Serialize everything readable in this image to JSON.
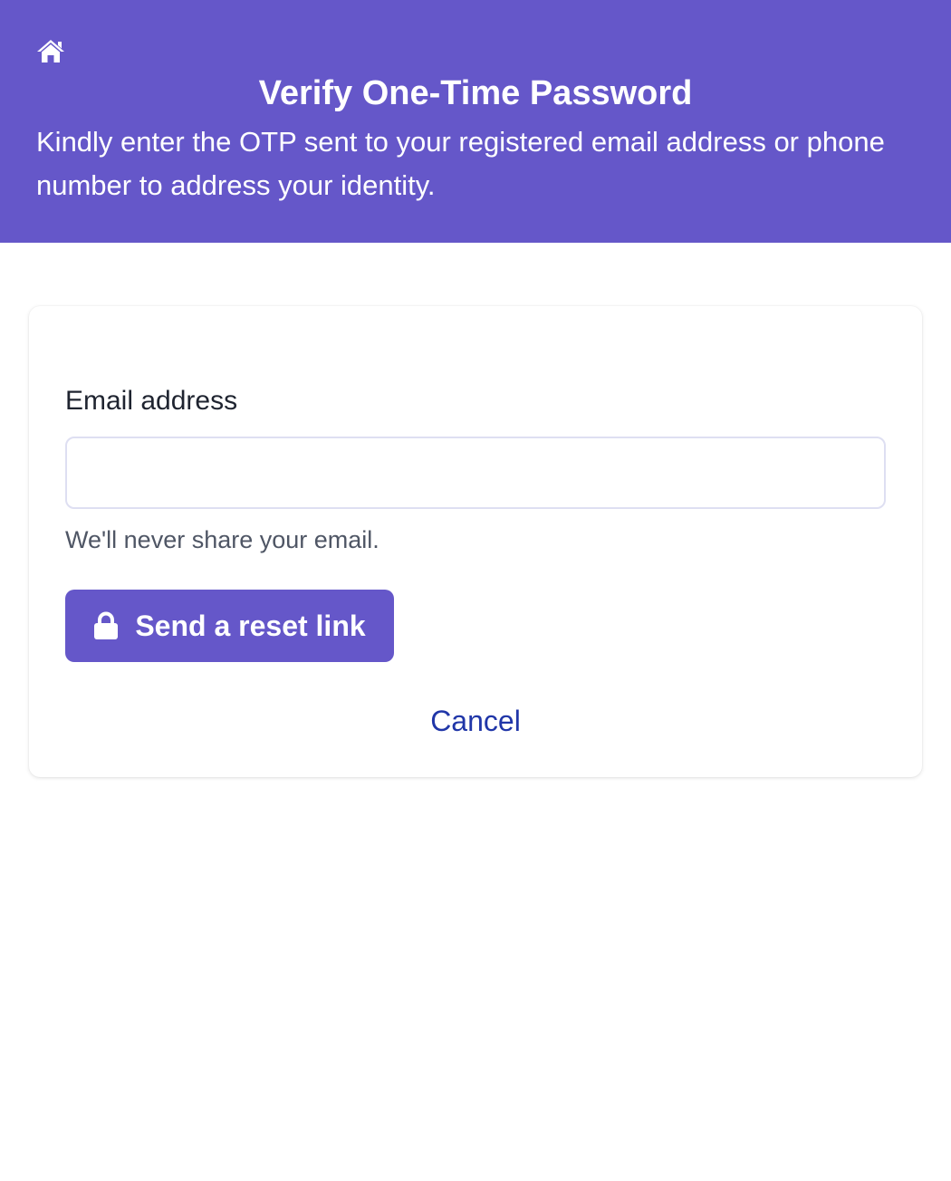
{
  "header": {
    "home_icon": "home-icon",
    "title": "Verify One-Time Password",
    "subtitle": "Kindly enter the OTP sent to your registered email address or phone number to address your identity."
  },
  "form": {
    "email_label": "Email address",
    "email_value": "",
    "email_placeholder": "",
    "email_help": "We'll never share your email.",
    "submit_icon": "lock-icon",
    "submit_label": "Send a reset link",
    "cancel_label": "Cancel"
  },
  "colors": {
    "brand": "#6557c9",
    "link": "#2036a8",
    "background": "#ffffff"
  }
}
